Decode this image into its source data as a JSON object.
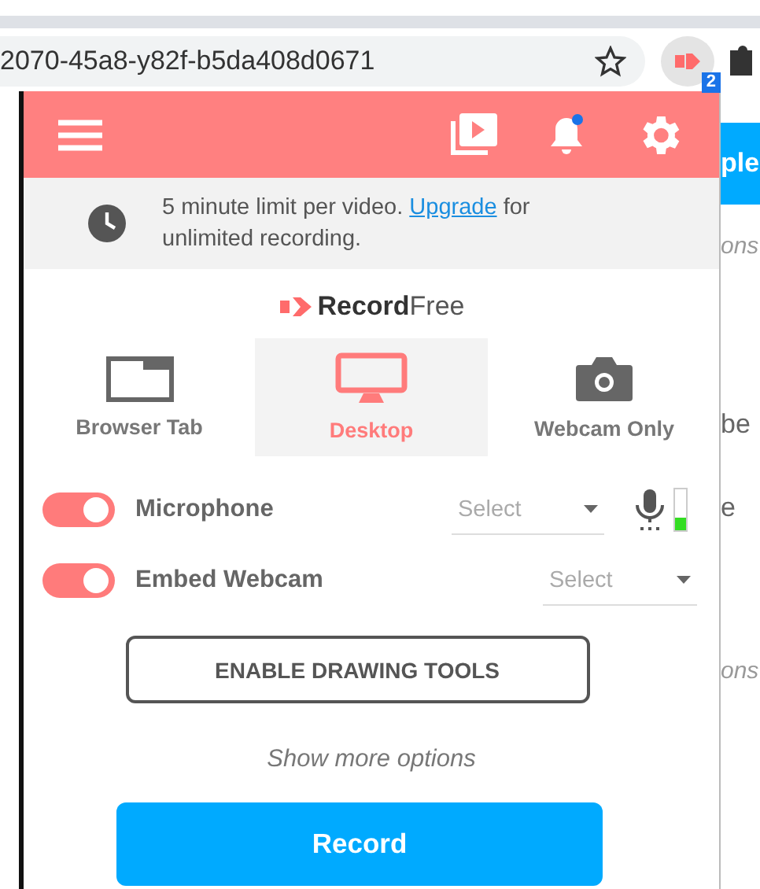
{
  "browser": {
    "url": "2070-45a8-y82f-b5da408d0671",
    "extension_badge": "2"
  },
  "header": {
    "notification_unread": true
  },
  "notice": {
    "before": "5 minute limit per video.",
    "link": "Upgrade",
    "after": "for unlimited recording."
  },
  "logo": "**Record**Free",
  "modes": [
    {
      "label": "Browser Tab",
      "kind": "tab",
      "selected": false
    },
    {
      "label": "Desktop",
      "kind": "monitor",
      "selected": true
    },
    {
      "label": "Webcam Only",
      "kind": "camera",
      "selected": false
    }
  ],
  "options": [
    {
      "label": "Microphone",
      "kind": "microphone",
      "on": true,
      "placeholder": "Select",
      "level": 0.3
    },
    {
      "label": "Embed Webcam",
      "kind": "webcam",
      "on": true,
      "placeholder": "Select"
    }
  ],
  "drawing_button": "ENABLE DRAWING TOOLS",
  "more_options": "Show more options",
  "record_button": "Record",
  "background_page": [
    {
      "kind": "button",
      "text": "ple"
    },
    {
      "kind": "italic",
      "text": "ons"
    },
    {
      "kind": "plain",
      "text": "be"
    },
    {
      "kind": "plain",
      "text": "e"
    },
    {
      "kind": "italic",
      "text": "ons"
    }
  ]
}
